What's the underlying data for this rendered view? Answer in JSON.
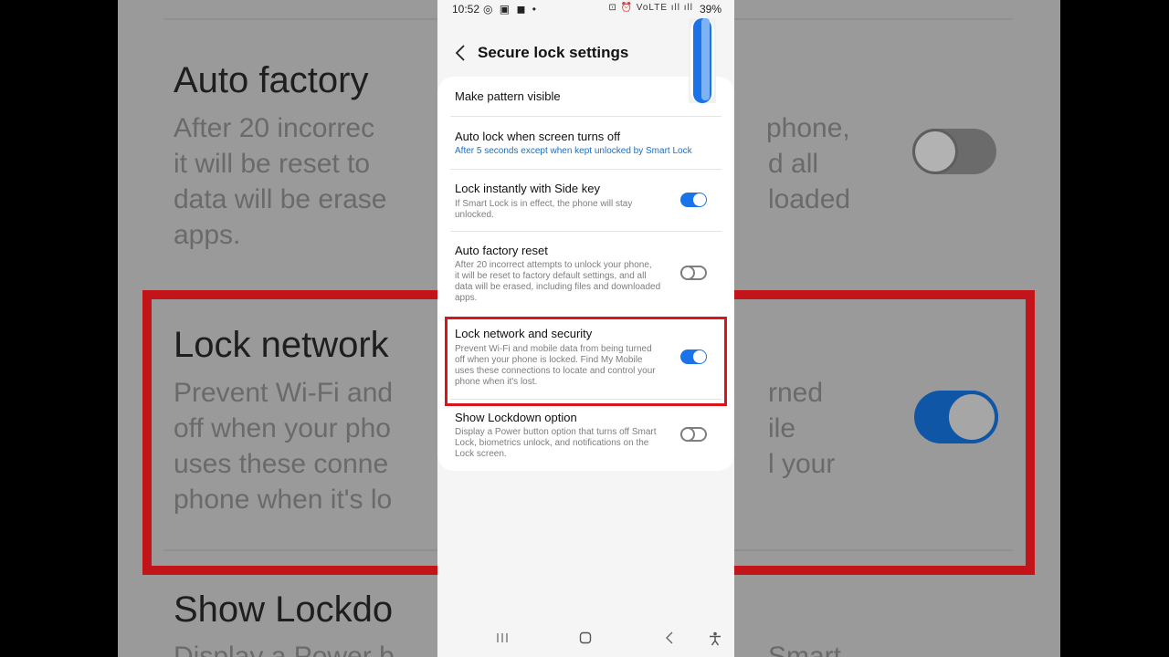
{
  "statusbar": {
    "time": "10:52",
    "left_icons": "◎ ▣ ◼ •",
    "right_icons": "⊡ ⏰ VoLTE ıll ıll",
    "battery": "39%"
  },
  "header": {
    "title": "Secure lock settings"
  },
  "settings": [
    {
      "title": "Make pattern visible"
    },
    {
      "title": "Auto lock when screen turns off",
      "subtitle": "After 5 seconds except when kept unlocked by Smart Lock"
    },
    {
      "title": "Lock instantly with Side key",
      "desc": [
        "If Smart Lock is in effect, the phone will stay",
        "unlocked."
      ],
      "toggle": true
    },
    {
      "title": "Auto factory reset",
      "desc": [
        "After 20 incorrect attempts to unlock your phone,",
        "it will be reset to factory default settings, and all",
        "data will be erased, including files and downloaded",
        "apps."
      ],
      "toggle": false
    },
    {
      "title": "Lock network and security",
      "desc": [
        "Prevent Wi-Fi and mobile data from being turned",
        "off when your phone is locked. Find My Mobile",
        "uses these connections to locate and control your",
        "phone when it's lost."
      ],
      "toggle": true
    },
    {
      "title": "Show Lockdown option",
      "desc": [
        "Display a Power button option that turns off Smart",
        "Lock, biometrics unlock, and notifications on the",
        "Lock screen."
      ],
      "toggle": false
    }
  ],
  "background": {
    "title1": "Auto factory",
    "desc1": [
      "After 20 incorrec",
      "it will be reset to",
      "data will be erase",
      "apps."
    ],
    "desc1_right": [
      "phone,",
      "d all",
      "loaded"
    ],
    "title2": "Lock network",
    "desc2": [
      "Prevent Wi-Fi and",
      "off when your pho",
      "uses these conne",
      "phone when it's lo"
    ],
    "desc2_right": [
      "rned",
      "ile",
      "l your"
    ],
    "title3": "Show Lockdo",
    "desc3": "Display a Power b",
    "desc3_right": "Smart"
  },
  "colors": {
    "accent": "#1a73e8",
    "highlight": "#d9141b",
    "link": "#1b6fc4"
  }
}
